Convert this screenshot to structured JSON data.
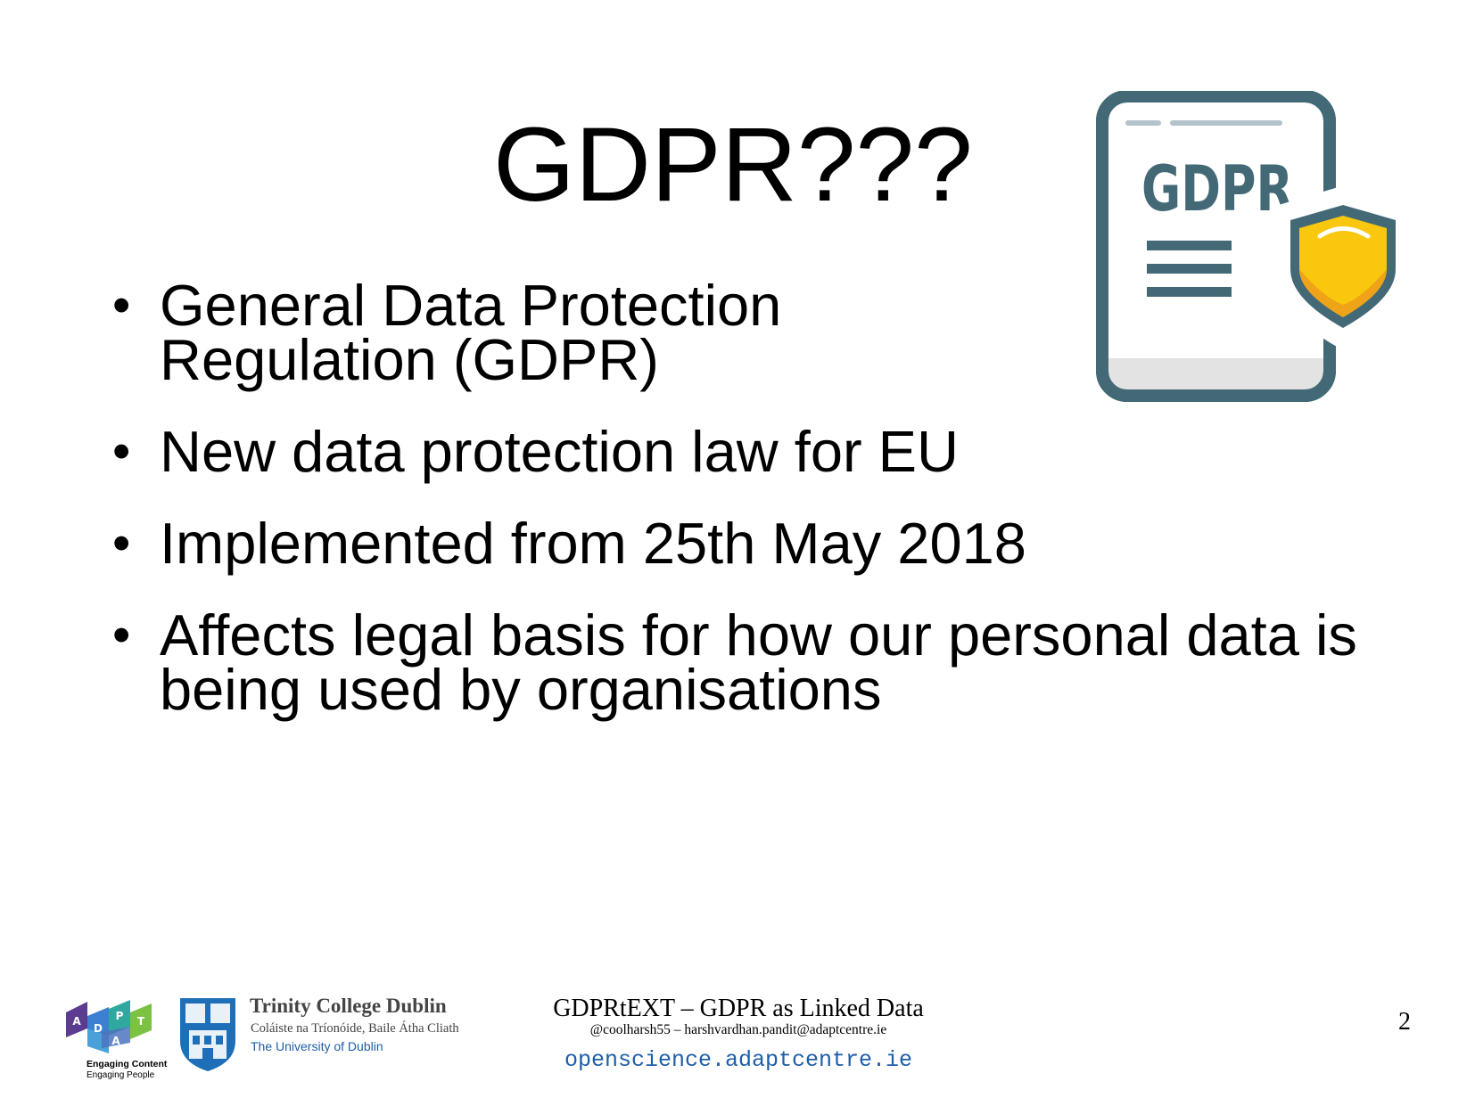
{
  "slide": {
    "title": "GDPR???",
    "icon": {
      "name": "gdpr-document-shield-icon",
      "label": "GDPR",
      "colors": {
        "frame": "#436977",
        "shield": "#f8c70e",
        "shield_shade": "#eea318"
      }
    },
    "bullets": [
      {
        "lines": [
          "General Data Protection",
          "Regulation (GDPR)"
        ]
      },
      {
        "lines": [
          "New data protection law for EU"
        ]
      },
      {
        "lines": [
          "Implemented from 25th May 2018"
        ]
      },
      {
        "lines": [
          "Affects legal basis for how our personal data is",
          "being used by organisations"
        ]
      }
    ]
  },
  "footer": {
    "adapt": {
      "letters": [
        "A",
        "D",
        "A",
        "P",
        "T"
      ],
      "tagline_1": "Engaging Content",
      "tagline_2": "Engaging People"
    },
    "tcd": {
      "name": "Trinity College Dublin",
      "irish_name": "Coláiste na Tríonóide, Baile Átha Cliath",
      "university": "The University of Dublin"
    },
    "title": "GDPRtEXT – GDPR as Linked Data",
    "contact": "@coolharsh55 –  harshvardhan.pandit@adaptcentre.ie",
    "url": "openscience.adaptcentre.ie",
    "page_number": "2"
  }
}
